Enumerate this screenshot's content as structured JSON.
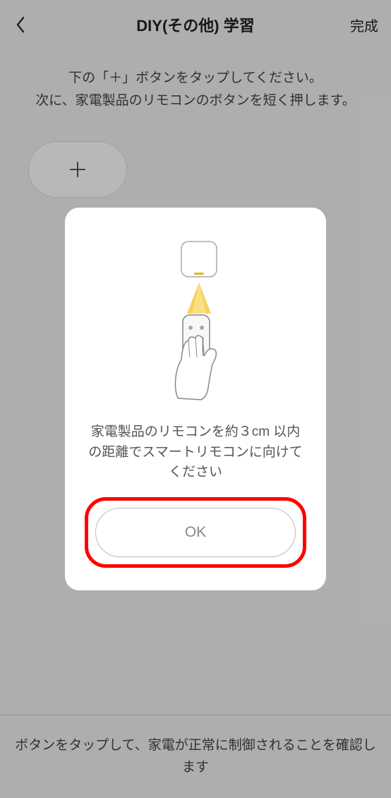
{
  "header": {
    "title": "DIY(その他) 学習",
    "done": "完成"
  },
  "instruction": "下の「＋」ボタンをタップしてください。\n次に、家電製品のリモコンのボタンを短く押します。",
  "modal": {
    "text": "家電製品のリモコンを約３cm 以内の距離でスマートリモコンに向けてください",
    "ok": "OK"
  },
  "footer": "ボタンをタップして、家電が正常に制御されることを確認します"
}
